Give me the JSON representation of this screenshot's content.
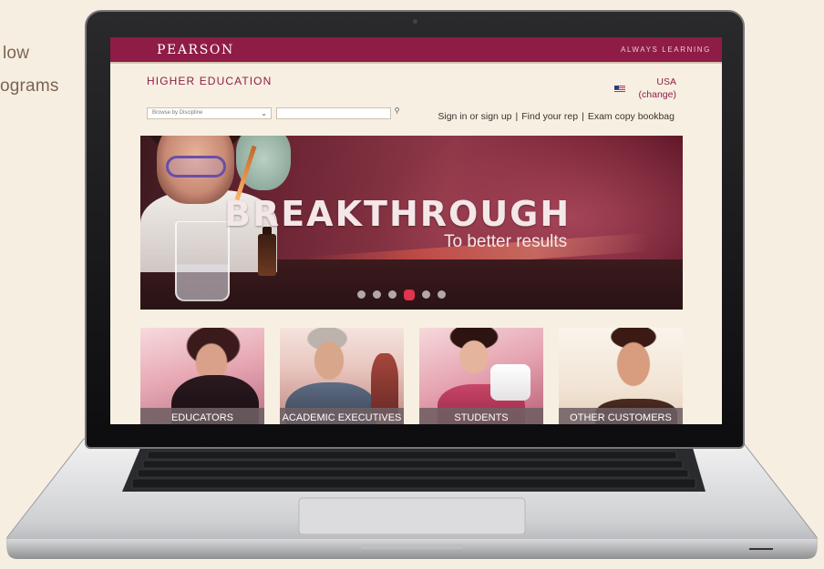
{
  "background_text": {
    "line1": "low",
    "line2": "ograms"
  },
  "site": {
    "brand": "PEARSON",
    "tagline": "ALWAYS LEARNING",
    "division": "HIGHER EDUCATION",
    "country": "USA",
    "country_change": "(change)",
    "flag_icon": "us-flag-icon"
  },
  "toolbar": {
    "discipline_placeholder": "Browse by Discipline",
    "search_value": "",
    "search_icon": "search-icon",
    "links": [
      "Sign in or sign up",
      "Find your rep",
      "Exam copy bookbag"
    ]
  },
  "hero": {
    "headline": "BREAKTHROUGH",
    "subheadline": "To better results",
    "slide_count": 6,
    "active_slide": 4
  },
  "audiences": [
    {
      "label": "EDUCATORS"
    },
    {
      "label": "ACADEMIC EXECUTIVES"
    },
    {
      "label": "STUDENTS"
    },
    {
      "label": "OTHER CUSTOMERS"
    }
  ],
  "colors": {
    "brand": "#8e1c47",
    "page_bg": "#f7f0e2",
    "active_dot": "#e0344f"
  }
}
